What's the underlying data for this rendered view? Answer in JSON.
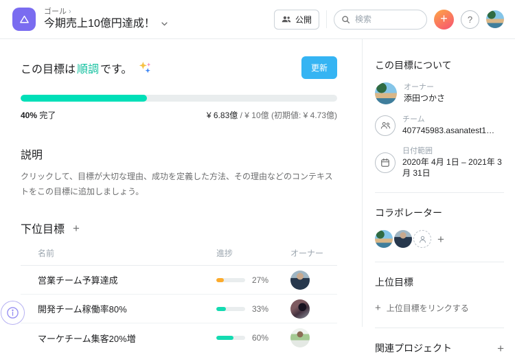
{
  "header": {
    "breadcrumb": "ゴール",
    "title": "今期売上10億円達成！",
    "share_label": "公開",
    "search_placeholder": "検索",
    "add_label": "+",
    "help_label": "?"
  },
  "status": {
    "prefix": "この目標は",
    "highlight": "順調",
    "suffix": "です。",
    "highlight_color": "#0dbf9d",
    "update_label": "更新"
  },
  "progress": {
    "percent": 40,
    "percent_label": "40%",
    "completed_label": "完了",
    "current_value": "¥ 6.83億",
    "target_rest": " / ¥ 10億 (初期値: ¥ 4.73億)",
    "bar_color": "#00dfb8"
  },
  "description": {
    "title": "説明",
    "placeholder": "クリックして、目標が大切な理由、成功を定義した方法、その理由などのコンテキストをこの目標に追加しましょう。"
  },
  "sub_goals": {
    "title": "下位目標",
    "add_label": "+",
    "columns": {
      "name": "名前",
      "progress": "進捗",
      "owner": "オーナー"
    },
    "rows": [
      {
        "name": "営業チーム予算達成",
        "percent": 27,
        "percent_label": "27%",
        "bar_color": "#fcab2c"
      },
      {
        "name": "開発チーム稼働率80%",
        "percent": 33,
        "percent_label": "33%",
        "bar_color": "#14dbb1"
      },
      {
        "name": "マーケチーム集客20%増",
        "percent": 60,
        "percent_label": "60%",
        "bar_color": "#14dbb1"
      }
    ]
  },
  "sidebar": {
    "about_title": "この目標について",
    "owner": {
      "label": "オーナー",
      "name": "添田つかさ"
    },
    "team": {
      "label": "チーム",
      "name": "407745983.asanatest1…"
    },
    "date_range": {
      "label": "日付範囲",
      "value": "2020年 4月 1日 – 2021年 3月 31日"
    },
    "collaborators_title": "コラボレーター",
    "collab_add_label": "+",
    "parent_goal": {
      "title": "上位目標",
      "link_label": "上位目標をリンクする",
      "link_plus": "+"
    },
    "related_projects": {
      "title": "関連プロジェクト",
      "add_label": "+"
    }
  }
}
